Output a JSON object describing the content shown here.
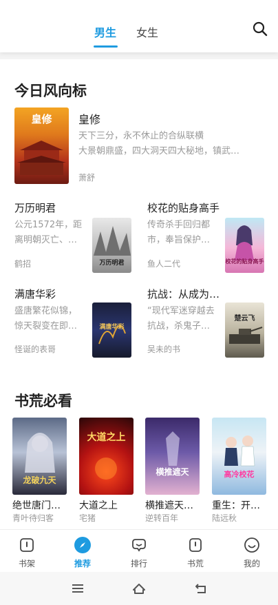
{
  "header": {
    "tabs": [
      {
        "label": "男生",
        "active": true
      },
      {
        "label": "女生",
        "active": false
      }
    ],
    "search_icon": "search-icon"
  },
  "sections": [
    {
      "title": "今日风向标",
      "featured": {
        "title": "皇修",
        "cover_text": "皇修",
        "description_line1": "天下三分，永不休止的合纵联横",
        "description_line2": "大景朝鼎盛，四大洞天四大秘地，镇武…",
        "author": "萧舒"
      },
      "books": [
        {
          "title": "万历明君",
          "desc_line1": "公元1572年，距",
          "desc_line2": "离明朝灭亡、…",
          "author": "鹤招",
          "cover_text": "万历明君"
        },
        {
          "title": "校花的贴身高手",
          "desc_line1": "传奇杀手回归都",
          "desc_line2": "市，奉旨保护…",
          "author": "鱼人二代",
          "cover_text": "校花的贴身高手"
        },
        {
          "title": "满唐华彩",
          "desc_line1": "盛唐繁花似锦，",
          "desc_line2": "惊天裂变在即…",
          "author": "怪诞的表哥",
          "cover_text": "满唐华彩"
        },
        {
          "title": "抗战：从成为…",
          "desc_line1": "“现代军迷穿越去",
          "desc_line2": "抗战，杀鬼子…",
          "author": "吴未的书",
          "cover_text": "楚云飞"
        }
      ]
    },
    {
      "title": "书荒必看",
      "books": [
        {
          "title": "绝世唐门…",
          "author": "青叶待归客",
          "cover_text": "龙破九天"
        },
        {
          "title": "大道之上",
          "author": "宅猪",
          "cover_text": "大道之上"
        },
        {
          "title": "横推遮天…",
          "author": "逆转百年",
          "cover_text": "横推遮天"
        },
        {
          "title": "重生：开…",
          "author": "陆远秋",
          "cover_text": "高冷校花"
        }
      ]
    }
  ],
  "bottom_nav": [
    {
      "label": "书架",
      "icon": "bookshelf-icon",
      "active": false
    },
    {
      "label": "推荐",
      "icon": "compass-icon",
      "active": true
    },
    {
      "label": "排行",
      "icon": "ranking-icon",
      "active": false
    },
    {
      "label": "书荒",
      "icon": "book-hunger-icon",
      "active": false
    },
    {
      "label": "我的",
      "icon": "profile-icon",
      "active": false
    }
  ],
  "colors": {
    "accent": "#1e9be0",
    "text": "#222222",
    "muted": "#999999"
  }
}
